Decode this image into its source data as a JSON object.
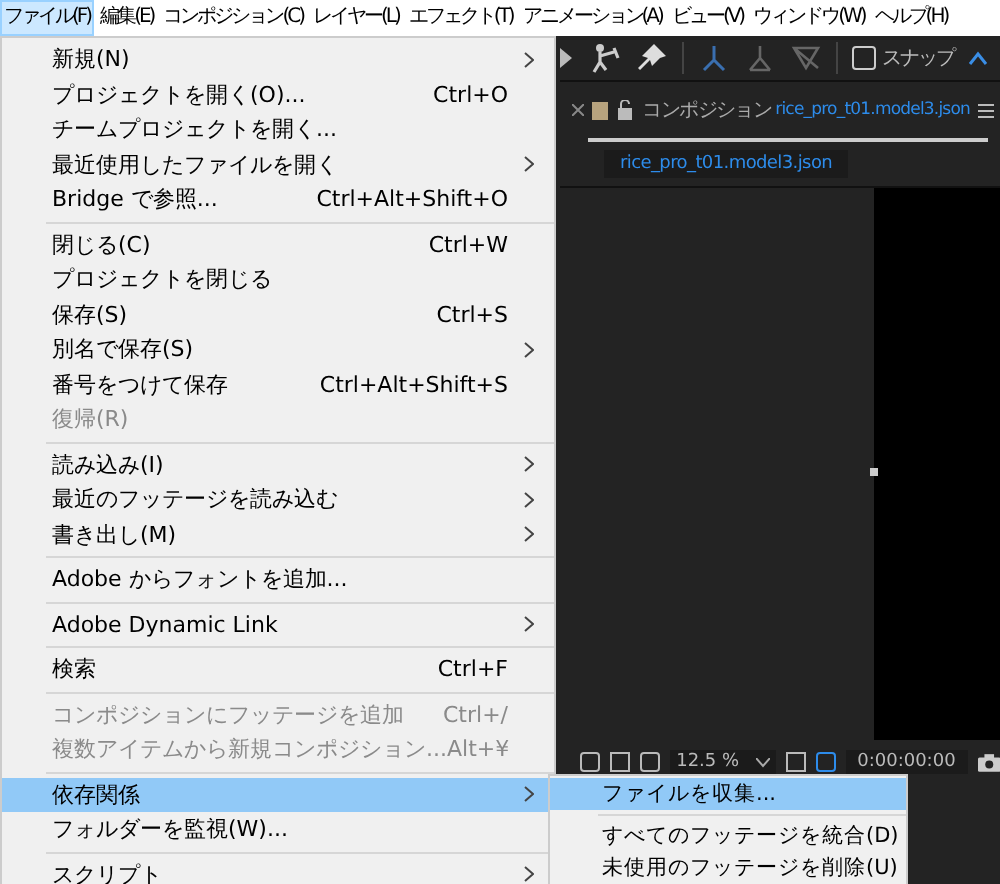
{
  "menubar": [
    {
      "label": "ファイル(F)",
      "selected": true
    },
    {
      "label": "編集(E)",
      "selected": false
    },
    {
      "label": "コンポジション(C)",
      "selected": false
    },
    {
      "label": "レイヤー(L)",
      "selected": false
    },
    {
      "label": "エフェクト(T)",
      "selected": false
    },
    {
      "label": "アニメーション(A)",
      "selected": false
    },
    {
      "label": "ビュー(V)",
      "selected": false
    },
    {
      "label": "ウィンドウ(W)",
      "selected": false
    },
    {
      "label": "ヘルプ(H)",
      "selected": false
    }
  ],
  "file_menu": [
    {
      "kind": "item",
      "label": "新規(N)",
      "submenu": true,
      "disabled": false,
      "selected": false
    },
    {
      "kind": "item",
      "label": "プロジェクトを開く(O)...",
      "shortcut": "Ctrl+O",
      "submenu": false,
      "disabled": false,
      "selected": false
    },
    {
      "kind": "item",
      "label": "チームプロジェクトを開く...",
      "submenu": false,
      "disabled": false,
      "selected": false
    },
    {
      "kind": "item",
      "label": "最近使用したファイルを開く",
      "submenu": true,
      "disabled": false,
      "selected": false
    },
    {
      "kind": "item",
      "label": "Bridge で参照...",
      "shortcut": "Ctrl+Alt+Shift+O",
      "submenu": false,
      "disabled": false,
      "selected": false
    },
    {
      "kind": "separator"
    },
    {
      "kind": "item",
      "label": "閉じる(C)",
      "shortcut": "Ctrl+W",
      "submenu": false,
      "disabled": false,
      "selected": false
    },
    {
      "kind": "item",
      "label": "プロジェクトを閉じる",
      "submenu": false,
      "disabled": false,
      "selected": false
    },
    {
      "kind": "item",
      "label": "保存(S)",
      "shortcut": "Ctrl+S",
      "submenu": false,
      "disabled": false,
      "selected": false
    },
    {
      "kind": "item",
      "label": "別名で保存(S)",
      "submenu": true,
      "disabled": false,
      "selected": false
    },
    {
      "kind": "item",
      "label": "番号をつけて保存",
      "shortcut": "Ctrl+Alt+Shift+S",
      "submenu": false,
      "disabled": false,
      "selected": false
    },
    {
      "kind": "item",
      "label": "復帰(R)",
      "submenu": false,
      "disabled": true,
      "selected": false
    },
    {
      "kind": "separator"
    },
    {
      "kind": "item",
      "label": "読み込み(I)",
      "submenu": true,
      "disabled": false,
      "selected": false
    },
    {
      "kind": "item",
      "label": "最近のフッテージを読み込む",
      "submenu": true,
      "disabled": false,
      "selected": false
    },
    {
      "kind": "item",
      "label": "書き出し(M)",
      "submenu": true,
      "disabled": false,
      "selected": false
    },
    {
      "kind": "separator"
    },
    {
      "kind": "item",
      "label": "Adobe からフォントを追加...",
      "submenu": false,
      "disabled": false,
      "selected": false
    },
    {
      "kind": "separator"
    },
    {
      "kind": "item",
      "label": "Adobe Dynamic Link",
      "submenu": true,
      "disabled": false,
      "selected": false
    },
    {
      "kind": "separator"
    },
    {
      "kind": "item",
      "label": "検索",
      "shortcut": "Ctrl+F",
      "submenu": false,
      "disabled": false,
      "selected": false
    },
    {
      "kind": "separator"
    },
    {
      "kind": "item",
      "label": "コンポジションにフッテージを追加",
      "shortcut": "Ctrl+/",
      "submenu": false,
      "disabled": true,
      "selected": false
    },
    {
      "kind": "item",
      "label": "複数アイテムから新規コンポジション...",
      "shortcut": "Alt+¥",
      "submenu": false,
      "disabled": true,
      "selected": false
    },
    {
      "kind": "separator"
    },
    {
      "kind": "item",
      "label": "依存関係",
      "submenu": true,
      "disabled": false,
      "selected": true
    },
    {
      "kind": "item",
      "label": "フォルダーを監視(W)...",
      "submenu": false,
      "disabled": false,
      "selected": false
    },
    {
      "kind": "separator"
    },
    {
      "kind": "item",
      "label": "スクリプト",
      "submenu": true,
      "disabled": false,
      "selected": false
    }
  ],
  "dependencies_submenu": [
    {
      "kind": "item",
      "label": "ファイルを収集...",
      "selected": true
    },
    {
      "kind": "separator"
    },
    {
      "kind": "item",
      "label": "すべてのフッテージを統合(D)",
      "selected": false
    },
    {
      "kind": "item",
      "label": "未使用のフッテージを削除(U)",
      "selected": false
    }
  ],
  "toolbar": {
    "snap_label": "スナップ",
    "snap_checked": false
  },
  "comp_panel": {
    "prefix": "コンポジション",
    "name": "rice_pro_t01.model3.json",
    "tab": "rice_pro_t01.model3.json"
  },
  "viewer_bar": {
    "zoom": "12.5 %",
    "timecode": "0:00:00:00"
  }
}
